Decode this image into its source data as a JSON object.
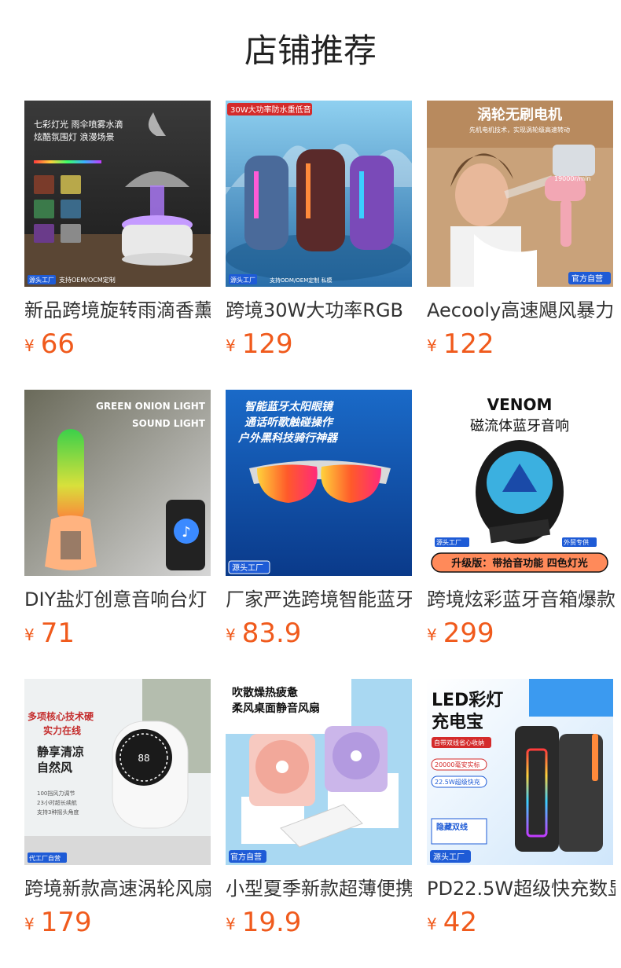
{
  "header": {
    "title": "店铺推荐"
  },
  "currency_symbol": "¥",
  "colors": {
    "price": "#f05a1c",
    "badge_blue": "#1e5bd6"
  },
  "products": [
    {
      "title": "新品跨境旋转雨滴香薰",
      "price": "66",
      "image": {
        "icon": "humidifier-image",
        "lines": [
          "七彩灯光 雨伞喷雾水滴",
          "炫酷氛围灯 浪漫场景"
        ],
        "badge": "源头工厂",
        "note": "支持OEM/OCM定制"
      }
    },
    {
      "title": "跨境30W大功率RGB",
      "price": "129",
      "image": {
        "icon": "speaker-image",
        "lines": [
          "30W大功率防水重低音"
        ],
        "badge": "源头工厂",
        "note": "支持ODM/OEM定制 私模"
      }
    },
    {
      "title": "Aecooly高速飓风暴力",
      "price": "122",
      "image": {
        "icon": "turbo-fan-image",
        "lines": [
          "涡轮无刷电机",
          "先机电机技术，实现涡轮级高速转动"
        ],
        "speed": "19000r/min",
        "badge": "官方自营"
      }
    },
    {
      "title": "DIY盐灯创意音响台灯",
      "price": "71",
      "image": {
        "icon": "salt-lamp-image",
        "lines": [
          "GREEN ONION LIGHT",
          "SOUND LIGHT"
        ]
      }
    },
    {
      "title": "厂家严选跨境智能蓝牙",
      "price": "83.9",
      "image": {
        "icon": "sunglasses-image",
        "lines": [
          "智能蓝牙太阳眼镜",
          "通话听歌触碰操作",
          "户外黑科技骑行神器"
        ],
        "badge": "源头工厂"
      }
    },
    {
      "title": "跨境炫彩蓝牙音箱爆款",
      "price": "299",
      "image": {
        "icon": "magnetic-speaker-image",
        "lines": [
          "VENOM",
          "磁流体蓝牙音响"
        ],
        "badge": "源头工厂",
        "badge2": "外贸专供",
        "footer": "升级版：带拾音功能 四色灯光"
      }
    },
    {
      "title": "跨境新款高速涡轮风扇",
      "price": "179",
      "image": {
        "icon": "desk-fan-image",
        "lines": [
          "多项核心技术硬",
          "实力在线",
          "静享清凉",
          "自然风"
        ],
        "bullets": [
          "100挡风力调节",
          "23小时超长续航",
          "支持3种摇头角度"
        ],
        "badge": "代工厂自营"
      }
    },
    {
      "title": "小型夏季新款超薄便携",
      "price": "19.9",
      "image": {
        "icon": "mini-fan-image",
        "lines": [
          "吹散燥热疲惫",
          "柔风桌面静音风扇"
        ],
        "badge": "官方自营"
      }
    },
    {
      "title": "PD22.5W超级快充数显",
      "price": "42",
      "image": {
        "icon": "power-bank-image",
        "lines": [
          "LED彩灯",
          "充电宝"
        ],
        "tags": [
          "自带双线省心收纳",
          "20000毫安实标",
          "22.5W超级快充"
        ],
        "highlight": "隐藏双线",
        "badge": "源头工厂"
      }
    }
  ]
}
